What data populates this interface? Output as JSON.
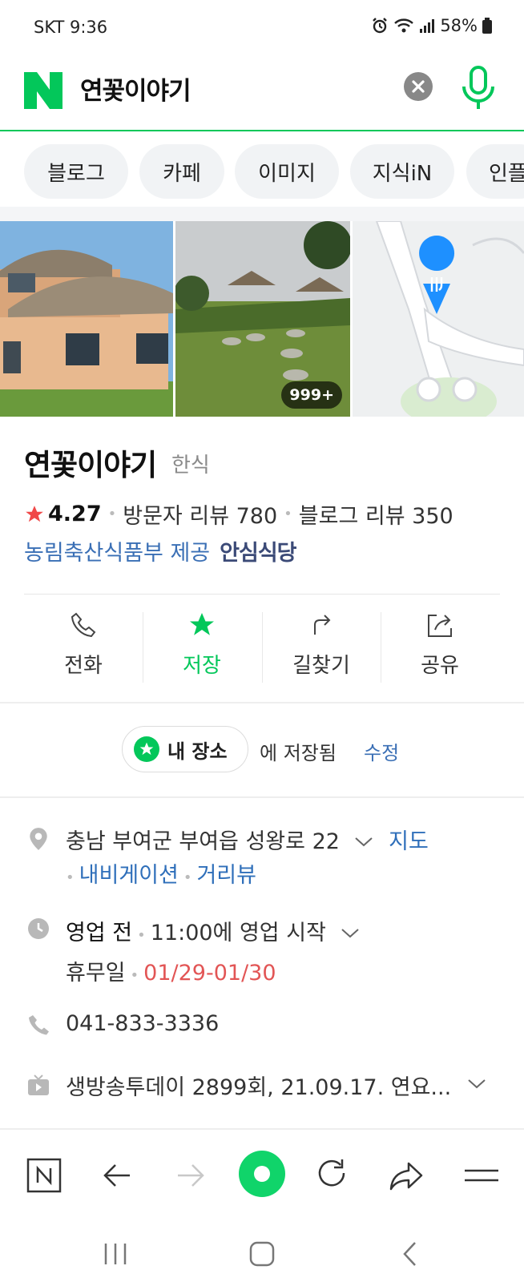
{
  "status_bar": {
    "carrier_time": "SKT 9:36",
    "battery": "58%"
  },
  "search": {
    "query": "연꽃이야기",
    "brand_color": "#03c75a"
  },
  "tabs": [
    {
      "label": "블로그"
    },
    {
      "label": "카페"
    },
    {
      "label": "이미지"
    },
    {
      "label": "지식iN"
    },
    {
      "label": "인플"
    }
  ],
  "photos": {
    "more_count": "999+"
  },
  "place": {
    "name": "연꽃이야기",
    "category": "한식",
    "rating": "4.27",
    "visitor_reviews": "방문자 리뷰 780",
    "blog_reviews": "블로그 리뷰 350",
    "provider": "농림축산식품부 제공",
    "safe_badge": "안심식당"
  },
  "actions": [
    {
      "label": "전화",
      "icon": "phone-icon"
    },
    {
      "label": "저장",
      "icon": "star-icon",
      "active": true
    },
    {
      "label": "길찾기",
      "icon": "directions-icon"
    },
    {
      "label": "공유",
      "icon": "share-icon"
    }
  ],
  "saved": {
    "chip_label": "내 장소",
    "suffix": "에 저장됨",
    "edit_label": "수정"
  },
  "details": {
    "address": "충남 부여군 부여읍 성왕로 22",
    "map_link": "지도",
    "navigation_link": "내비게이션",
    "streetview_link": "거리뷰",
    "hours_status": "영업 전",
    "hours_open": "11:00에 영업 시작",
    "holiday_label": "휴무일",
    "holiday_dates": "01/29-01/30",
    "phone": "041-833-3336",
    "tv": "생방송투데이 2899회, 21.09.17. 연요..."
  },
  "accent_colors": {
    "green": "#03c75a",
    "link": "#2f6fba",
    "red": "#e25555",
    "star": "#f04848"
  }
}
